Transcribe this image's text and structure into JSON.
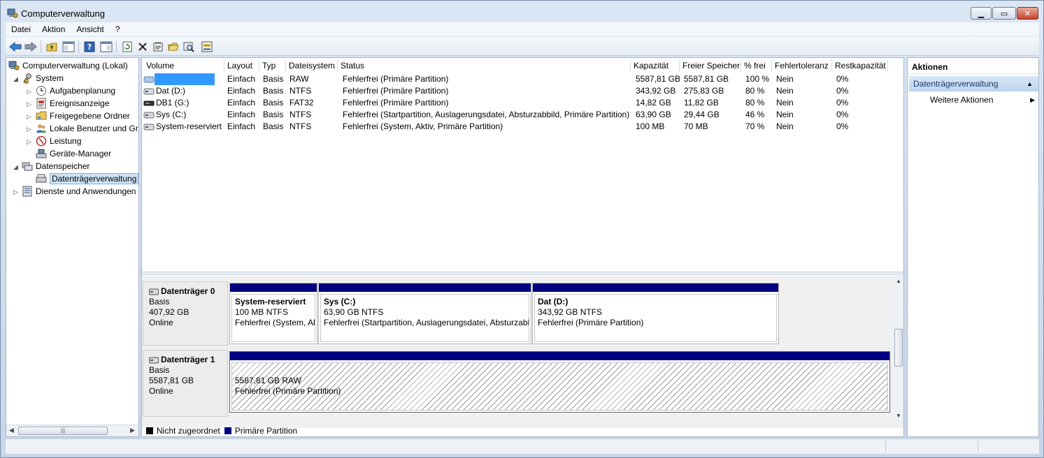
{
  "window": {
    "title": "Computerverwaltung"
  },
  "menu": [
    "Datei",
    "Aktion",
    "Ansicht",
    "?"
  ],
  "tree": {
    "root": "Computerverwaltung (Lokal)",
    "system": "System",
    "aufgabenplanung": "Aufgabenplanung",
    "ereignisanzeige": "Ereignisanzeige",
    "freigegebene_ordner": "Freigegebene Ordner",
    "lokale_benutzer": "Lokale Benutzer und Gr",
    "leistung": "Leistung",
    "geraete_manager": "Geräte-Manager",
    "datenspeicher": "Datenspeicher",
    "datentraegerverwaltung": "Datenträgerverwaltung",
    "dienste": "Dienste und Anwendungen"
  },
  "columns": [
    "Volume",
    "Layout",
    "Typ",
    "Dateisystem",
    "Status",
    "Kapazität",
    "Freier Speicher",
    "% frei",
    "Fehlertoleranz",
    "Restkapazität"
  ],
  "volumes": [
    {
      "volume": "",
      "layout": "Einfach",
      "typ": "Basis",
      "fs": "RAW",
      "status": "Fehlerfrei (Primäre Partition)",
      "kapazitaet": "5587,81 GB",
      "frei": "5587,81 GB",
      "prozent": "100 %",
      "fehlertoleranz": "Nein",
      "rest": "0%"
    },
    {
      "volume": "Dat (D:)",
      "layout": "Einfach",
      "typ": "Basis",
      "fs": "NTFS",
      "status": "Fehlerfrei (Primäre Partition)",
      "kapazitaet": "343,92 GB",
      "frei": "275,83 GB",
      "prozent": "80 %",
      "fehlertoleranz": "Nein",
      "rest": "0%"
    },
    {
      "volume": "DB1 (G:)",
      "layout": "Einfach",
      "typ": "Basis",
      "fs": "FAT32",
      "status": "Fehlerfrei (Primäre Partition)",
      "kapazitaet": "14,82 GB",
      "frei": "11,82 GB",
      "prozent": "80 %",
      "fehlertoleranz": "Nein",
      "rest": "0%"
    },
    {
      "volume": "Sys (C:)",
      "layout": "Einfach",
      "typ": "Basis",
      "fs": "NTFS",
      "status": "Fehlerfrei (Startpartition, Auslagerungsdatei, Absturzabbild, Primäre Partition)",
      "kapazitaet": "63,90 GB",
      "frei": "29,44 GB",
      "prozent": "46 %",
      "fehlertoleranz": "Nein",
      "rest": "0%"
    },
    {
      "volume": "System-reserviert",
      "layout": "Einfach",
      "typ": "Basis",
      "fs": "NTFS",
      "status": "Fehlerfrei (System, Aktiv, Primäre Partition)",
      "kapazitaet": "100 MB",
      "frei": "70 MB",
      "prozent": "70 %",
      "fehlertoleranz": "Nein",
      "rest": "0%"
    }
  ],
  "disks": [
    {
      "name": "Datenträger 0",
      "type": "Basis",
      "size": "407,92 GB",
      "state": "Online",
      "partitions": [
        {
          "name": "System-reserviert",
          "size": "100 MB NTFS",
          "status": "Fehlerfrei (System, Ak"
        },
        {
          "name": "Sys  (C:)",
          "size": "63,90 GB NTFS",
          "status": "Fehlerfrei (Startpartition, Auslagerungsdatei, Absturzabl"
        },
        {
          "name": "Dat  (D:)",
          "size": "343,92 GB NTFS",
          "status": "Fehlerfrei (Primäre Partition)"
        }
      ]
    },
    {
      "name": "Datenträger 1",
      "type": "Basis",
      "size": "5587,81 GB",
      "state": "Online",
      "partitions": [
        {
          "name": "",
          "size": "5587,81 GB RAW",
          "status": "Fehlerfrei (Primäre Partition)"
        }
      ]
    }
  ],
  "legend": {
    "unallocated": "Nicht zugeordnet",
    "primary": "Primäre Partition",
    "unallocated_color": "#000000",
    "primary_color": "#000080"
  },
  "actions": {
    "header": "Aktionen",
    "section": "Datenträgerverwaltung",
    "more": "Weitere Aktionen"
  },
  "icons": [
    "back-icon",
    "forward-icon",
    "up-folder-icon",
    "console-tree-icon",
    "help-icon",
    "action-pane-icon",
    "refresh-icon",
    "delete-icon",
    "properties-icon",
    "open-icon",
    "search-icon",
    "disk-settings-icon"
  ]
}
